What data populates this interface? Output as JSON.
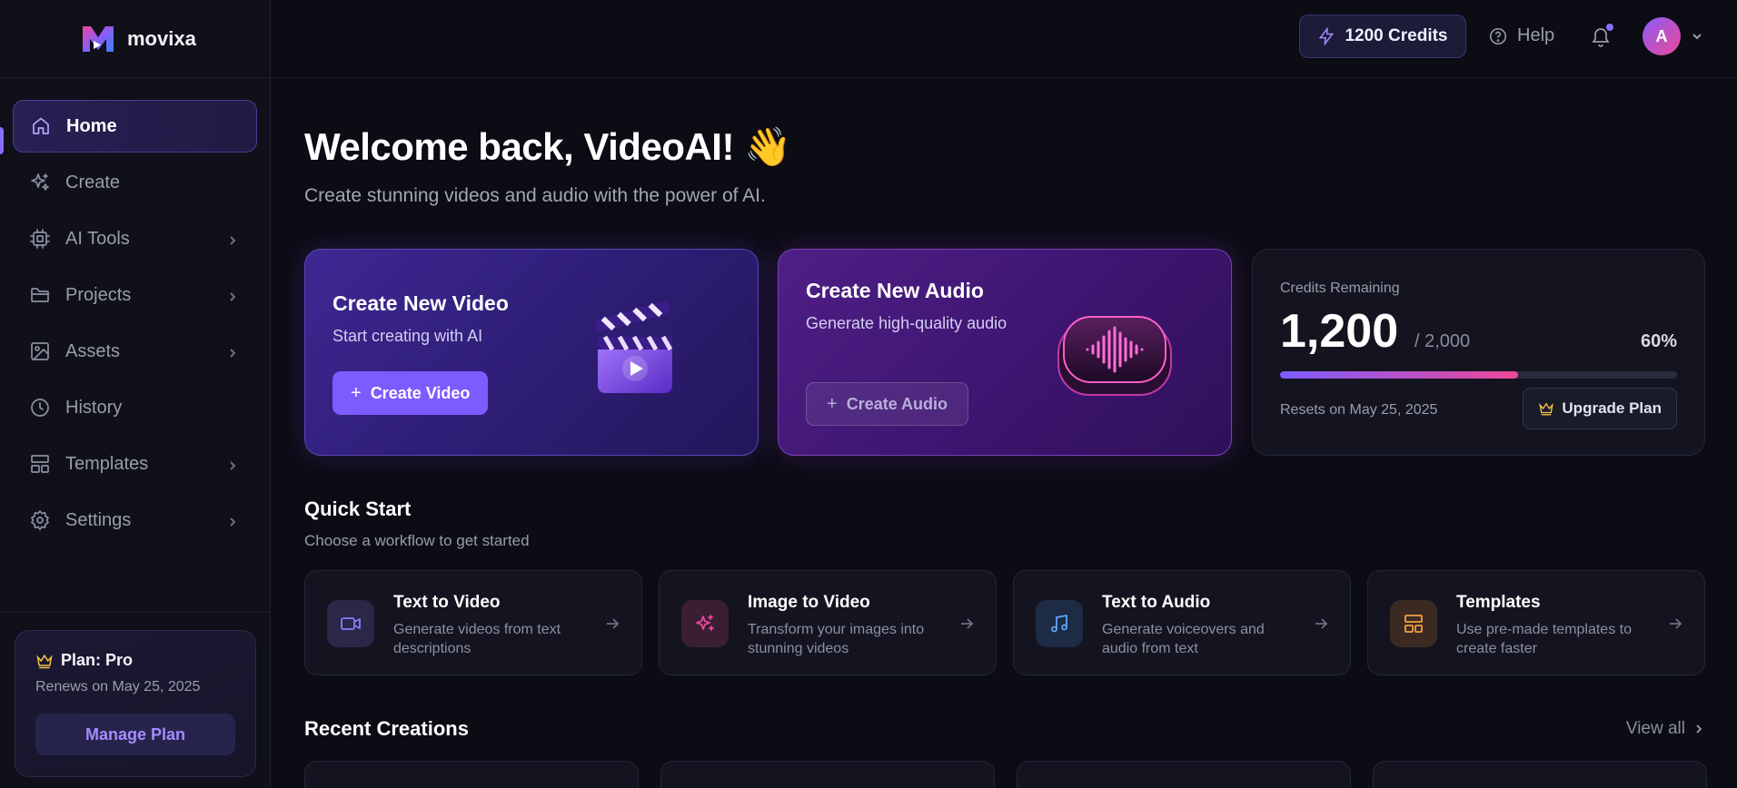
{
  "brand": {
    "name": "movixa"
  },
  "sidebar": {
    "items": [
      {
        "label": "Home",
        "icon": "home-icon",
        "active": true,
        "has_children": false
      },
      {
        "label": "Create",
        "icon": "sparkles-icon",
        "active": false,
        "has_children": false
      },
      {
        "label": "AI Tools",
        "icon": "cpu-icon",
        "active": false,
        "has_children": true
      },
      {
        "label": "Projects",
        "icon": "folder-icon",
        "active": false,
        "has_children": true
      },
      {
        "label": "Assets",
        "icon": "image-icon",
        "active": false,
        "has_children": true
      },
      {
        "label": "History",
        "icon": "clock-icon",
        "active": false,
        "has_children": false
      },
      {
        "label": "Templates",
        "icon": "layout-icon",
        "active": false,
        "has_children": true
      },
      {
        "label": "Settings",
        "icon": "gear-icon",
        "active": false,
        "has_children": true
      }
    ],
    "plan": {
      "title": "Plan: Pro",
      "renews": "Renews on May 25, 2025",
      "button_label": "Manage Plan"
    }
  },
  "topbar": {
    "credits_label": "1200 Credits",
    "help_label": "Help",
    "has_notification": true,
    "avatar_initial": "A"
  },
  "main": {
    "welcome": "Welcome back, VideoAI! 👋",
    "subtitle": "Create stunning videos and audio with the power of AI.",
    "hero_video": {
      "title": "Create New Video",
      "subtitle": "Start creating with AI",
      "button_label": "Create Video"
    },
    "hero_audio": {
      "title": "Create New Audio",
      "subtitle": "Generate high-quality audio",
      "button_label": "Create Audio"
    },
    "credits": {
      "label": "Credits Remaining",
      "remaining": "1,200",
      "total": "/ 2,000",
      "percent_label": "60%",
      "fraction": 0.6,
      "reset": "Resets on May 25, 2025",
      "upgrade_label": "Upgrade Plan"
    },
    "quick_start": {
      "title": "Quick Start",
      "subtitle": "Choose a workflow to get started",
      "cards": [
        {
          "name": "Text to Video",
          "desc": "Generate videos from text descriptions",
          "icon": "video-camera-icon",
          "color": "#8b7cff",
          "bg": "#2a2748"
        },
        {
          "name": "Image to Video",
          "desc": "Transform your images into stunning videos",
          "icon": "sparkle-icon",
          "color": "#ec4899",
          "bg": "#3a1f33"
        },
        {
          "name": "Text to Audio",
          "desc": "Generate voiceovers and audio from text",
          "icon": "music-note-icon",
          "color": "#60a5fa",
          "bg": "#1d2b44"
        },
        {
          "name": "Templates",
          "desc": "Use pre-made templates to create faster",
          "icon": "template-icon",
          "color": "#f59e42",
          "bg": "#3a2a22"
        }
      ]
    },
    "recent": {
      "title": "Recent Creations",
      "view_all": "View all"
    }
  },
  "colors": {
    "accent": "#7c5cff",
    "background": "#0b0c14",
    "gold": "#f5c04a"
  }
}
